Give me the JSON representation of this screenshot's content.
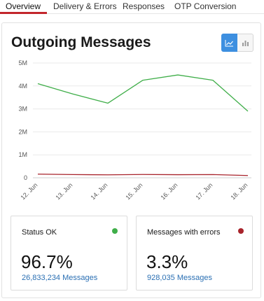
{
  "tabs": [
    {
      "label": "Overview",
      "active": true
    },
    {
      "label": "Delivery & Errors",
      "active": false
    },
    {
      "label": "Responses",
      "active": false
    },
    {
      "label": "OTP Conversion",
      "active": false
    }
  ],
  "card": {
    "title": "Outgoing Messages",
    "view_toggle": {
      "selected": "line-chart",
      "options": [
        "line-chart-icon",
        "bar-chart-icon"
      ]
    }
  },
  "colors": {
    "accent": "#3d8fe0",
    "tab_underline": "#c3262c",
    "series_ok": "#3fae49",
    "series_errors": "#a8232b",
    "link": "#2a6fb3"
  },
  "chart_data": {
    "type": "line",
    "x": [
      "12. Jun",
      "13. Jun",
      "14. Jun",
      "15. Jun",
      "16. Jun",
      "17. Jun",
      "18. Jun"
    ],
    "y_ticks": [
      "0",
      "1M",
      "2M",
      "3M",
      "4M",
      "5M"
    ],
    "ylim": [
      0,
      5000000
    ],
    "grid": true,
    "series": [
      {
        "color": "#3fae49",
        "values": [
          4100000,
          3650000,
          3250000,
          4250000,
          4480000,
          4250000,
          2900000
        ]
      },
      {
        "color": "#a8232b",
        "values": [
          160000,
          140000,
          130000,
          145000,
          135000,
          140000,
          100000
        ]
      }
    ]
  },
  "stats": {
    "ok": {
      "label": "Status OK",
      "value": "96.7%",
      "sub": "26,833,234 Messages",
      "dot_color": "#3fae49"
    },
    "errors": {
      "label": "Messages with errors",
      "value": "3.3%",
      "sub": "928,035 Messages",
      "dot_color": "#a8232b"
    }
  }
}
